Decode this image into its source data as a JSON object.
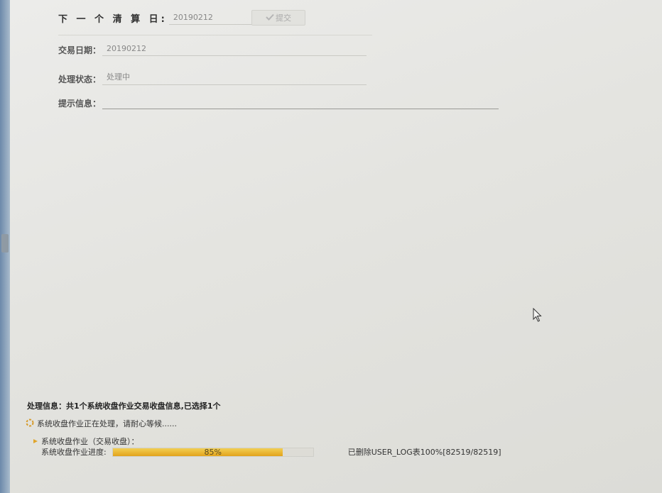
{
  "form": {
    "next_date_label": "下 一 个 清 算 日:",
    "next_date_value": "20190212",
    "submit_label": "提交",
    "trade_date_label": "交易日期：",
    "trade_date_value": "20190212",
    "status_label": "处理状态：",
    "status_value": "处理中",
    "hint_label": "提示信息：",
    "hint_value": ""
  },
  "footer": {
    "info": "处理信息：共1个系统收盘作业交易收盘信息,已选择1个",
    "processing_msg": "系统收盘作业正在处理，请耐心等候......",
    "job_title": "系统收盘作业（交易收盘）：",
    "progress_label": "系统收盘作业进度:",
    "progress_percent": 85,
    "progress_text": "85%",
    "progress_detail": "已删除USER_LOG表100%[82519/82519]"
  },
  "icons": {
    "submit": "checkmark-icon",
    "processing": "spinner-icon",
    "job": "triangle-bullet-icon",
    "cursor": "mouse-pointer-icon"
  },
  "colors": {
    "progress_fill": "#e8b22a",
    "progress_track": "#dddcd6",
    "window_strip": "#7f98b4"
  }
}
